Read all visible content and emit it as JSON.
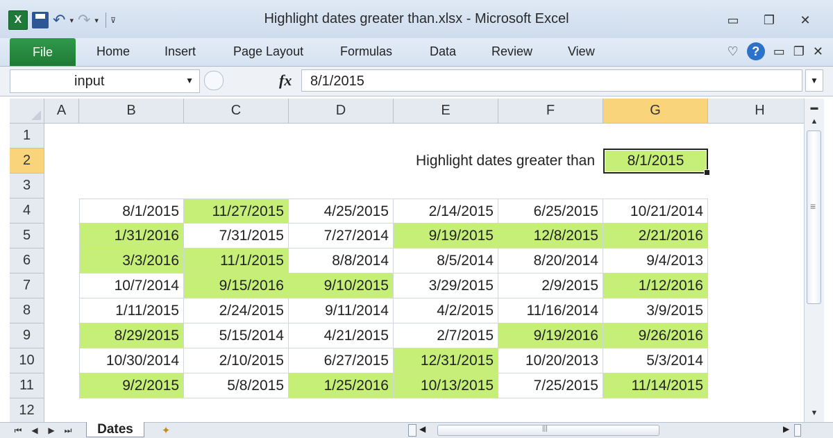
{
  "window": {
    "title": "Highlight dates greater than.xlsx  -  Microsoft Excel",
    "minimize_glyph": "▭",
    "restore_glyph": "❐",
    "close_glyph": "✕"
  },
  "qat": {
    "app_letter": "X",
    "undo_glyph": "↶",
    "redo_glyph": "↷",
    "dropdown_glyph": "▾",
    "customize_glyph": "⊽"
  },
  "ribbon": {
    "file_label": "File",
    "tabs": [
      "Home",
      "Insert",
      "Page Layout",
      "Formulas",
      "Data",
      "Review",
      "View"
    ],
    "icons": [
      "minimize-ribbon-icon",
      "help-icon",
      "doc-minimize-icon",
      "doc-restore-icon",
      "doc-close-icon"
    ],
    "help_glyph": "?"
  },
  "formula_bar": {
    "name_box": "input",
    "fx_label": "fx",
    "value": "8/1/2015"
  },
  "sheet": {
    "columns": [
      "A",
      "B",
      "C",
      "D",
      "E",
      "F",
      "G",
      "H"
    ],
    "rows": [
      "1",
      "2",
      "3",
      "4",
      "5",
      "6",
      "7",
      "8",
      "9",
      "10",
      "11",
      "12"
    ],
    "selected_column": "G",
    "selected_row": "2",
    "highlight_color": "#c6ef77",
    "label_text": "Highlight dates greater than",
    "input_value": "8/1/2015",
    "dates": [
      [
        "8/1/2015",
        "11/27/2015",
        "4/25/2015",
        "2/14/2015",
        "6/25/2015",
        "10/21/2014"
      ],
      [
        "1/31/2016",
        "7/31/2015",
        "7/27/2014",
        "9/19/2015",
        "12/8/2015",
        "2/21/2016"
      ],
      [
        "3/3/2016",
        "11/1/2015",
        "8/8/2014",
        "8/5/2014",
        "8/20/2014",
        "9/4/2013"
      ],
      [
        "10/7/2014",
        "9/15/2016",
        "9/10/2015",
        "3/29/2015",
        "2/9/2015",
        "1/12/2016"
      ],
      [
        "1/11/2015",
        "2/24/2015",
        "9/11/2014",
        "4/2/2015",
        "11/16/2014",
        "3/9/2015"
      ],
      [
        "8/29/2015",
        "5/15/2014",
        "4/21/2015",
        "2/7/2015",
        "9/19/2016",
        "9/26/2016"
      ],
      [
        "10/30/2014",
        "2/10/2015",
        "6/27/2015",
        "12/31/2015",
        "10/20/2013",
        "5/3/2014"
      ],
      [
        "9/2/2015",
        "5/8/2015",
        "1/25/2016",
        "10/13/2015",
        "7/25/2015",
        "11/14/2015"
      ]
    ],
    "highlighted": [
      [
        false,
        true,
        false,
        false,
        false,
        false
      ],
      [
        true,
        false,
        false,
        true,
        true,
        true
      ],
      [
        true,
        true,
        false,
        false,
        false,
        false
      ],
      [
        false,
        true,
        true,
        false,
        false,
        true
      ],
      [
        false,
        false,
        false,
        false,
        false,
        false
      ],
      [
        true,
        false,
        false,
        false,
        true,
        true
      ],
      [
        false,
        false,
        false,
        true,
        false,
        false
      ],
      [
        true,
        false,
        true,
        true,
        false,
        true
      ]
    ]
  },
  "bottom": {
    "sheet_tab": "Dates",
    "nav_glyphs": [
      "⏮",
      "◀",
      "▶",
      "⏭"
    ]
  }
}
